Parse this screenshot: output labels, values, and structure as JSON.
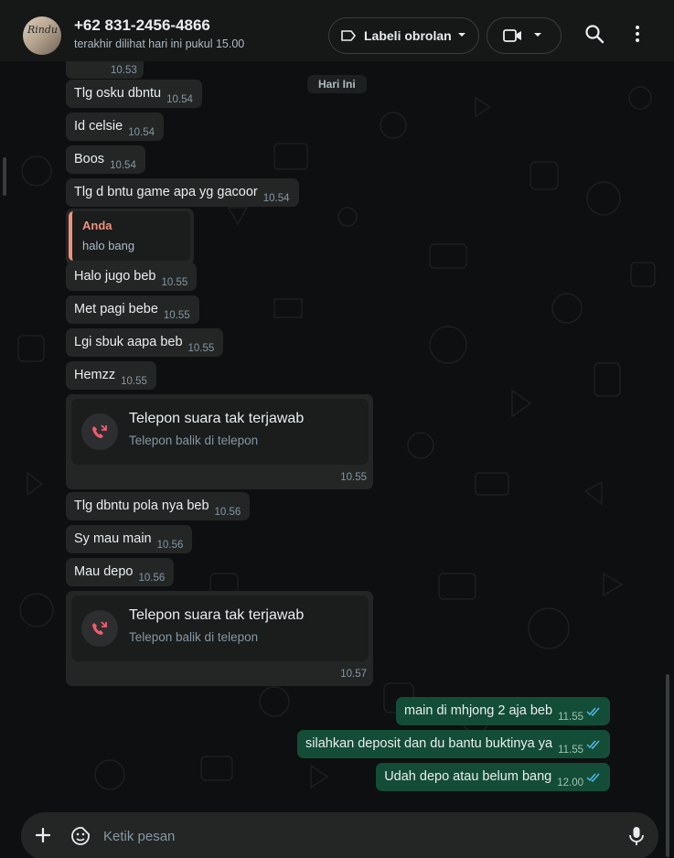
{
  "header": {
    "avatar_text": "Rindu",
    "contact_name": "+62 831-2456-4866",
    "status": "terakhir dilihat hari ini pukul 15.00",
    "label_button": "Labeli obrolan"
  },
  "chat": {
    "partial_time": "10.53",
    "day_chip": "Hari Ini",
    "incoming_1": [
      {
        "text": "Tlg   osku dbntu",
        "time": "10.54"
      },
      {
        "text": "Id celsie",
        "time": "10.54"
      },
      {
        "text": "Boos",
        "time": "10.54"
      },
      {
        "text": "Tlg d bntu game apa yg gacoor",
        "time": "10.54"
      }
    ],
    "reply": {
      "quoted_name": "Anda",
      "quoted_text": "halo bang"
    },
    "incoming_2": [
      {
        "text": "Halo jugo beb",
        "time": "10.55"
      },
      {
        "text": "Met pagi bebe",
        "time": "10.55"
      },
      {
        "text": "Lgi sbuk aapa beb",
        "time": "10.55"
      },
      {
        "text": "Hemzz",
        "time": "10.55"
      }
    ],
    "calls": [
      {
        "title": "Telepon suara tak terjawab",
        "subtitle": "Telepon balik di telepon",
        "time": "10.55"
      },
      {
        "title": "Telepon suara tak terjawab",
        "subtitle": "Telepon balik di telepon",
        "time": "10.57"
      }
    ],
    "incoming_3": [
      {
        "text": "Tlg dbntu pola nya beb",
        "time": "10.56"
      },
      {
        "text": "Sy mau main",
        "time": "10.56"
      },
      {
        "text": "Mau depo",
        "time": "10.56"
      }
    ],
    "outgoing": [
      {
        "text": "main di mhjong 2 aja beb",
        "time": "11.55"
      },
      {
        "text": "silahkan deposit dan du bantu buktinya ya",
        "time": "11.55"
      },
      {
        "text": "Udah depo atau belum bang",
        "time": "12.00"
      }
    ]
  },
  "composer": {
    "placeholder": "Ketik pesan"
  },
  "colors": {
    "outgoing_bubble": "#144d37",
    "incoming_bubble": "#242626",
    "missed_call": "#f15c6d",
    "read_tick": "#53bdeb",
    "quote_accent": "#f0917a"
  }
}
